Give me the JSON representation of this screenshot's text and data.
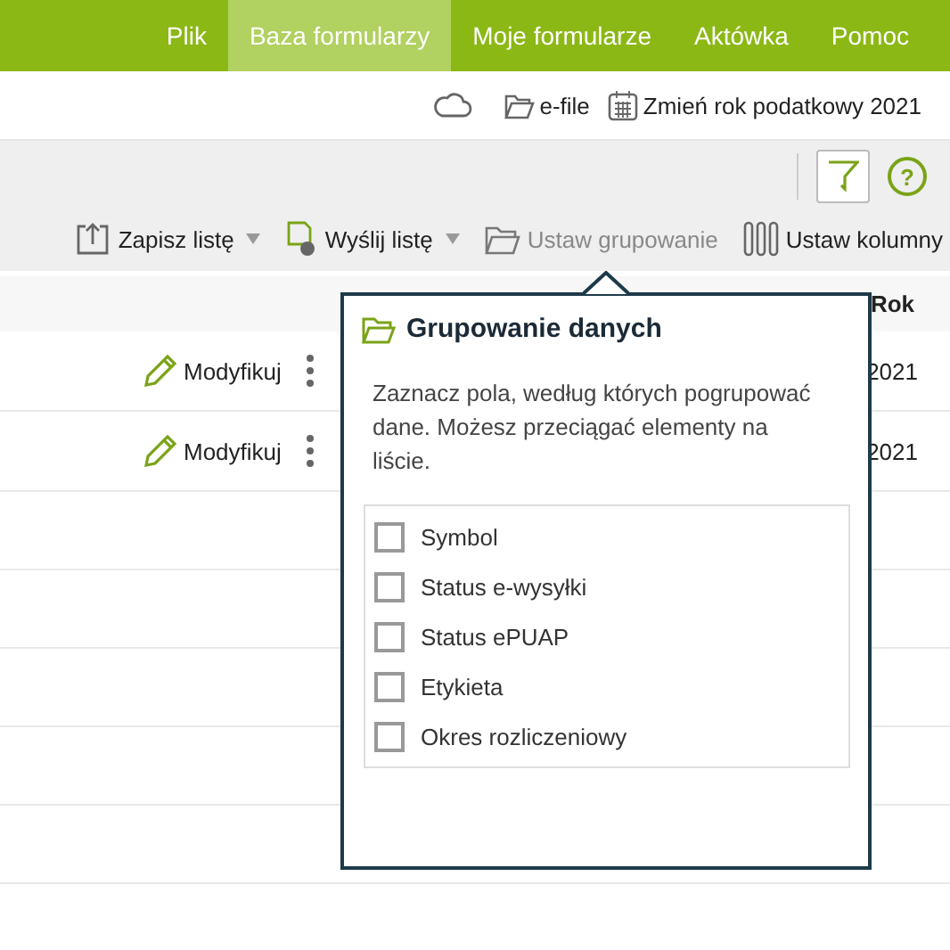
{
  "menu": [
    {
      "label": "Plik",
      "selected": false
    },
    {
      "label": "Baza formularzy",
      "selected": true
    },
    {
      "label": "Moje formularze",
      "selected": false
    },
    {
      "label": "Aktówka",
      "selected": false
    },
    {
      "label": "Pomoc",
      "selected": false
    }
  ],
  "topbar": {
    "efile": "e-file",
    "year_link": "Zmień rok podatkowy 2021"
  },
  "toolbar": [
    {
      "label": "Zapisz listę",
      "kind": "save",
      "dropdown": true,
      "disabled": false
    },
    {
      "label": "Wyślij listę",
      "kind": "send",
      "dropdown": true,
      "disabled": false
    },
    {
      "label": "Ustaw grupowanie",
      "kind": "group",
      "dropdown": false,
      "disabled": true
    },
    {
      "label": "Ustaw kolumny",
      "kind": "columns",
      "dropdown": false,
      "disabled": false
    }
  ],
  "help": "?",
  "table": {
    "columns": [
      "Rok"
    ],
    "rows": [
      {
        "action": "Modyfikuj",
        "year": "2021"
      },
      {
        "action": "Modyfikuj",
        "year": "2021"
      }
    ]
  },
  "popover": {
    "title": "Grupowanie danych",
    "description": "Zaznacz pola, według których pogrupować dane. Możesz przeciągać elementy na liście.",
    "fields": [
      {
        "label": "Symbol",
        "checked": false
      },
      {
        "label": "Status e-wysyłki",
        "checked": false
      },
      {
        "label": "Status ePUAP",
        "checked": false
      },
      {
        "label": "Etykieta",
        "checked": false
      },
      {
        "label": "Okres rozliczeniowy",
        "checked": false
      }
    ]
  }
}
